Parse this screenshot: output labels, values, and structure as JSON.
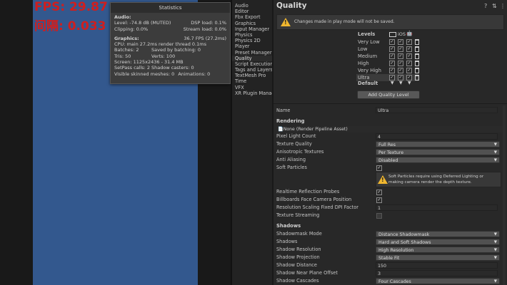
{
  "game": {
    "fps_line": "FPS: 29.87",
    "latency_line": "间隔: 0.033"
  },
  "stats": {
    "title": "Statistics",
    "audio_head": "Audio:",
    "level": "Level: -74.8 dB (MUTED)",
    "dsp": "DSP load: 0.1%",
    "clipping": "Clipping: 0.0%",
    "stream": "Stream load: 0.0%",
    "graphics_head": "Graphics:",
    "fps": "36.7 FPS (27.2ms)",
    "cpu": "CPU: main 27.2ms  render thread 0.1ms",
    "batches": "Batches: 2",
    "saved_batching": "Saved by batching: 0",
    "tris": "Tris: 50",
    "verts": "Verts: 100",
    "screen": "Screen: 1125x2436 - 31.4 MB",
    "setpass": "SetPass calls: 2",
    "shadow_casters": "Shadow casters: 0",
    "skinned": "Visible skinned meshes: 0",
    "animations": "Animations: 0"
  },
  "categories": [
    {
      "label": "Audio",
      "selected": false
    },
    {
      "label": "Editor",
      "selected": false
    },
    {
      "label": "Fbx Export",
      "selected": false
    },
    {
      "label": "Graphics",
      "selected": false
    },
    {
      "label": "Input Manager",
      "selected": false
    },
    {
      "label": "Physics",
      "selected": false
    },
    {
      "label": "Physics 2D",
      "selected": false
    },
    {
      "label": "Player",
      "selected": false
    },
    {
      "label": "Preset Manager",
      "selected": false
    },
    {
      "label": "Quality",
      "selected": true
    },
    {
      "label": "Script Execution",
      "selected": false
    },
    {
      "label": "Tags and Layers",
      "selected": false
    },
    {
      "label": "TextMesh Pro",
      "selected": false
    },
    {
      "label": "Time",
      "selected": false
    },
    {
      "label": "VFX",
      "selected": false
    },
    {
      "label": "XR Plugin Manage",
      "selected": false
    }
  ],
  "inspector": {
    "title": "Quality",
    "icons": [
      "help-icon",
      "preset-icon",
      "more-icon"
    ],
    "play_mode_warning": "Changes made in play mode will not be saved.",
    "levels_header": "Levels",
    "platform_ios": "iOS",
    "levels": [
      {
        "name": "Very Low",
        "selected": false
      },
      {
        "name": "Low",
        "selected": false
      },
      {
        "name": "Medium",
        "selected": false
      },
      {
        "name": "High",
        "selected": false
      },
      {
        "name": "Very High",
        "selected": false
      },
      {
        "name": "Ultra",
        "selected": true
      }
    ],
    "default_label": "Default",
    "add_level_button": "Add Quality Level",
    "name_label": "Name",
    "name_value": "Ultra",
    "rendering_header": "Rendering",
    "pipeline_value": "None (Render Pipeline Asset)",
    "props": {
      "pixel_light_count_label": "Pixel Light Count",
      "pixel_light_count_value": "4",
      "texture_quality_label": "Texture Quality",
      "texture_quality_value": "Full Res",
      "anisotropic_label": "Anisotropic Textures",
      "anisotropic_value": "Per Texture",
      "anti_aliasing_label": "Anti Aliasing",
      "anti_aliasing_value": "Disabled",
      "soft_particles_label": "Soft Particles",
      "soft_particles_checked": true,
      "soft_particles_warning": "Soft Particles require using Deferred Lighting or making camera render the depth texture.",
      "realtime_reflection_label": "Realtime Reflection Probes",
      "billboards_label": "Billboards Face Camera Position",
      "resolution_scaling_label": "Resolution Scaling Fixed DPI Factor",
      "resolution_scaling_value": "1",
      "texture_streaming_label": "Texture Streaming"
    },
    "shadows_header": "Shadows",
    "shadows": {
      "shadowmask_mode_label": "Shadowmask Mode",
      "shadowmask_mode_value": "Distance Shadowmask",
      "shadows_label": "Shadows",
      "shadows_value": "Hard and Soft Shadows",
      "shadow_resolution_label": "Shadow Resolution",
      "shadow_resolution_value": "High Resolution",
      "shadow_projection_label": "Shadow Projection",
      "shadow_projection_value": "Stable Fit",
      "shadow_distance_label": "Shadow Distance",
      "shadow_distance_value": "150",
      "shadow_near_plane_label": "Shadow Near Plane Offset",
      "shadow_near_plane_value": "3",
      "shadow_cascades_label": "Shadow Cascades",
      "shadow_cascades_value": "Four Cascades"
    }
  },
  "colors": {
    "game_canvas": "#33588e",
    "fps_text": "#d01e1e",
    "warning": "#f0b72f"
  }
}
